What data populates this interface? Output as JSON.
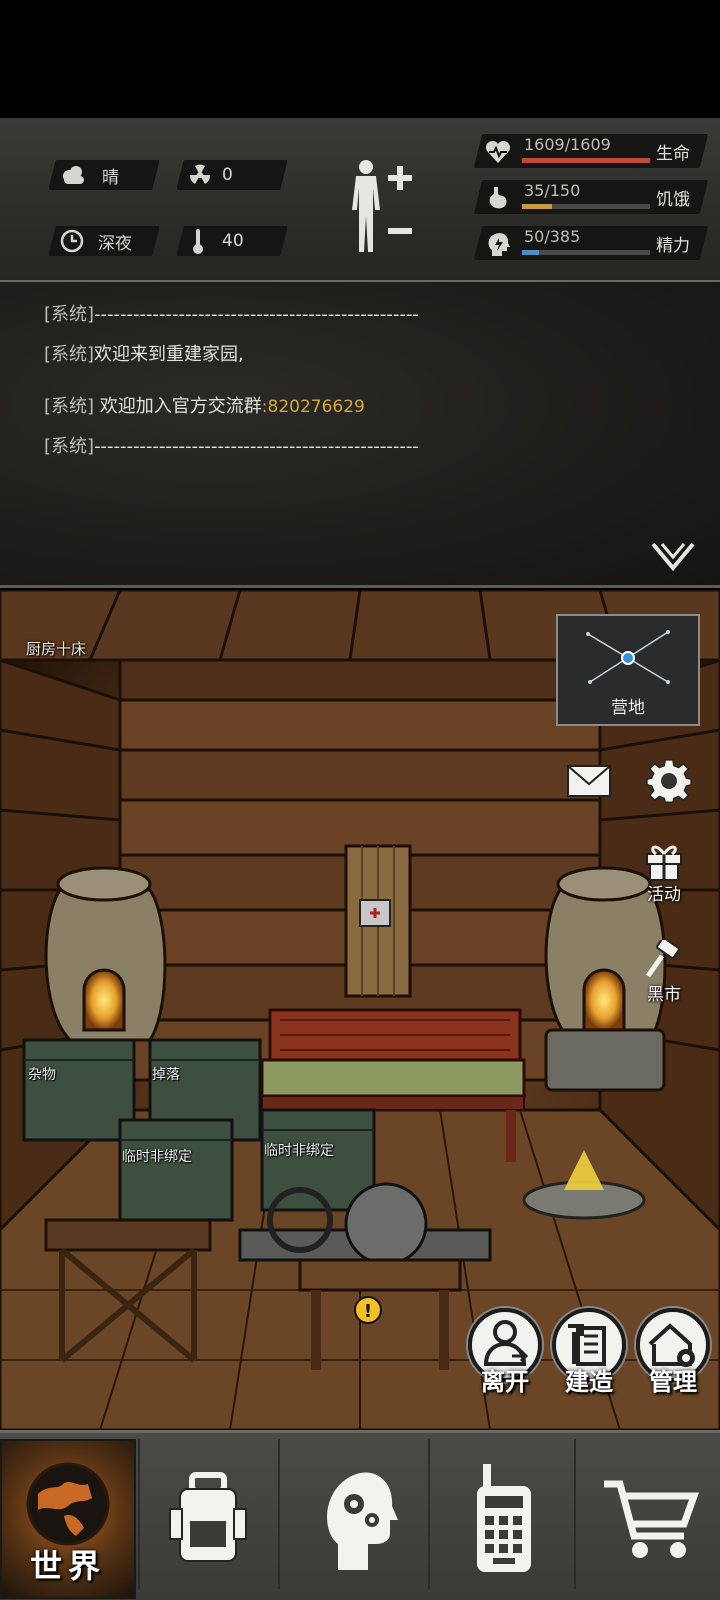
{
  "status": {
    "weather": "晴",
    "radiation": "0",
    "time_of_day": "深夜",
    "temperature": "40",
    "health": {
      "value": "1609/1609",
      "label": "生命",
      "fraction": 1.0,
      "color": "#c04a3c"
    },
    "hunger": {
      "value": "35/150",
      "label": "饥饿",
      "fraction": 0.233,
      "color": "#c59a42"
    },
    "energy": {
      "value": "50/385",
      "label": "精力",
      "fraction": 0.13,
      "color": "#4a8fc8"
    }
  },
  "log": {
    "lines": [
      {
        "prefix": "[系统]",
        "text": "--------------------------------------------------",
        "highlight": ""
      },
      {
        "prefix": "[系统]",
        "text": "欢迎来到重建家园,",
        "highlight": ""
      },
      {
        "prefix": "[系统]",
        "text": " 欢迎加入官方交流群",
        "highlight": ":820276629"
      },
      {
        "prefix": "[系统]",
        "text": "--------------------------------------------------",
        "highlight": ""
      }
    ]
  },
  "scene": {
    "room_name": "厨房十床",
    "minimap_label": "营地",
    "side_buttons": {
      "events": "活动",
      "black_market": "黑市"
    },
    "containers": [
      "杂物",
      "掉落",
      "临时非绑定",
      "临时非绑定"
    ],
    "actions": {
      "leave": "离开",
      "build": "建造",
      "manage": "管理"
    }
  },
  "nav": {
    "world": "世界",
    "items": [
      "backpack-icon",
      "skills-icon",
      "radio-icon",
      "shop-cart-icon"
    ]
  }
}
